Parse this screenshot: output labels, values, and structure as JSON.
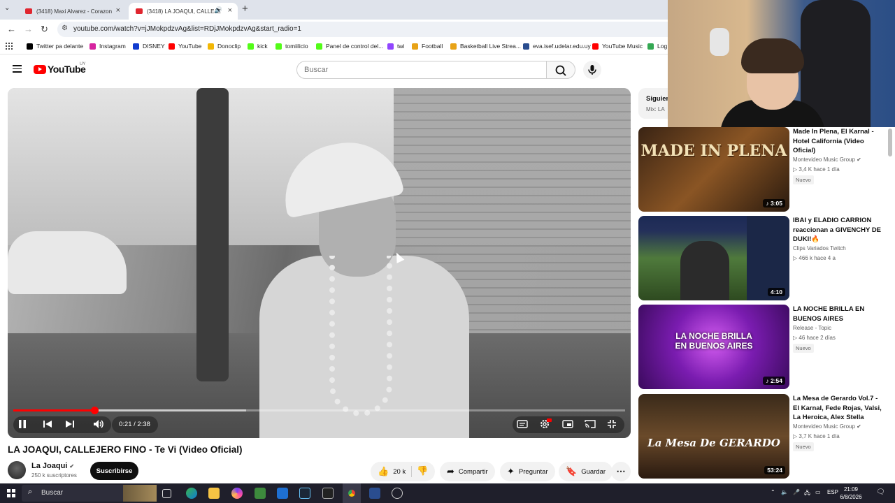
{
  "browser": {
    "tabs": [
      {
        "label": "(3418) Maxi Alvarez - Corazon",
        "active": false
      },
      {
        "label": "(3418) LA JOAQUI, CALLEJE",
        "active": true
      }
    ],
    "url": "youtube.com/watch?v=jJMokpdzvAg&list=RDjJMokpdzvAg&start_radio=1",
    "bookmarks": [
      {
        "label": "Twitter pa delante",
        "color": "#000000"
      },
      {
        "label": "Instagram",
        "color": "#d6249f"
      },
      {
        "label": "DISNEY",
        "color": "#113ccf"
      },
      {
        "label": "YouTube",
        "color": "#ff0000"
      },
      {
        "label": "Donoclip",
        "color": "#f2b705"
      },
      {
        "label": "kick",
        "color": "#53fc18"
      },
      {
        "label": "tomiilicio",
        "color": "#53fc18"
      },
      {
        "label": "Panel de control del...",
        "color": "#53fc18"
      },
      {
        "label": "twi",
        "color": "#9146ff"
      },
      {
        "label": "Football",
        "color": "#e8a317"
      },
      {
        "label": "Basketball Live Strea...",
        "color": "#e8a317"
      },
      {
        "label": "eva.isef.udelar.edu.uy",
        "color": "#2a4d8f"
      },
      {
        "label": "YouTube Music",
        "color": "#ff0000"
      },
      {
        "label": "Log",
        "color": "#34a853"
      }
    ]
  },
  "youtube": {
    "logo_text": "YouTube",
    "country_code": "UY",
    "search_placeholder": "Buscar"
  },
  "player": {
    "time": "0:21 / 2:38",
    "progress": 0.133,
    "state": "playing"
  },
  "video": {
    "title": "LA JOAQUI, CALLEJERO FINO - Te Vi (Video Oficial)",
    "channel": "La Joaqui",
    "subscribers": "250 k suscriptores",
    "subscribe_label": "Suscribirse",
    "likes": "20 k",
    "share_label": "Compartir",
    "ask_label": "Preguntar",
    "save_label": "Guardar"
  },
  "sidebar": {
    "mix_title": "Siguien",
    "mix_subtitle": "Mix: LA",
    "recommendations": [
      {
        "title": "Made In Plena, El Karnal - Hotel California (Video Oficial)",
        "channel": "Montevideo Music Group",
        "views": "3,4 K",
        "age": "hace 1 día",
        "badge": "Nuevo",
        "duration": "3:05",
        "thumb_text": "MADE IN PLENA"
      },
      {
        "title": "IBAI y ELADIO CARRION reaccionan a GIVENCHY DE DUKI!🔥",
        "channel": "Clips Variados Twitch",
        "views": "466 k",
        "age": "hace 4 a",
        "badge": "",
        "duration": "4:10",
        "thumb_text": ""
      },
      {
        "title": "LA NOCHE BRILLA EN BUENOS AIRES",
        "channel": "Release - Topic",
        "views": "46",
        "age": "hace 2 días",
        "badge": "Nuevo",
        "duration": "2:54",
        "thumb_text": "LA NOCHE BRILLA EN BUENOS AIRES"
      },
      {
        "title": "La Mesa de Gerardo Vol.7 - El Karnal, Fede Rojas, Valsi, La Heroica, Alex Stella",
        "channel": "Montevideo Music Group",
        "views": "3,7 K",
        "age": "hace 1 día",
        "badge": "Nuevo",
        "duration": "53:24",
        "thumb_text": "La Mesa De GERARDO"
      }
    ]
  },
  "taskbar": {
    "search_label": "Buscar",
    "language": "ESP",
    "time": "21:09",
    "date": "6/8/2026"
  }
}
